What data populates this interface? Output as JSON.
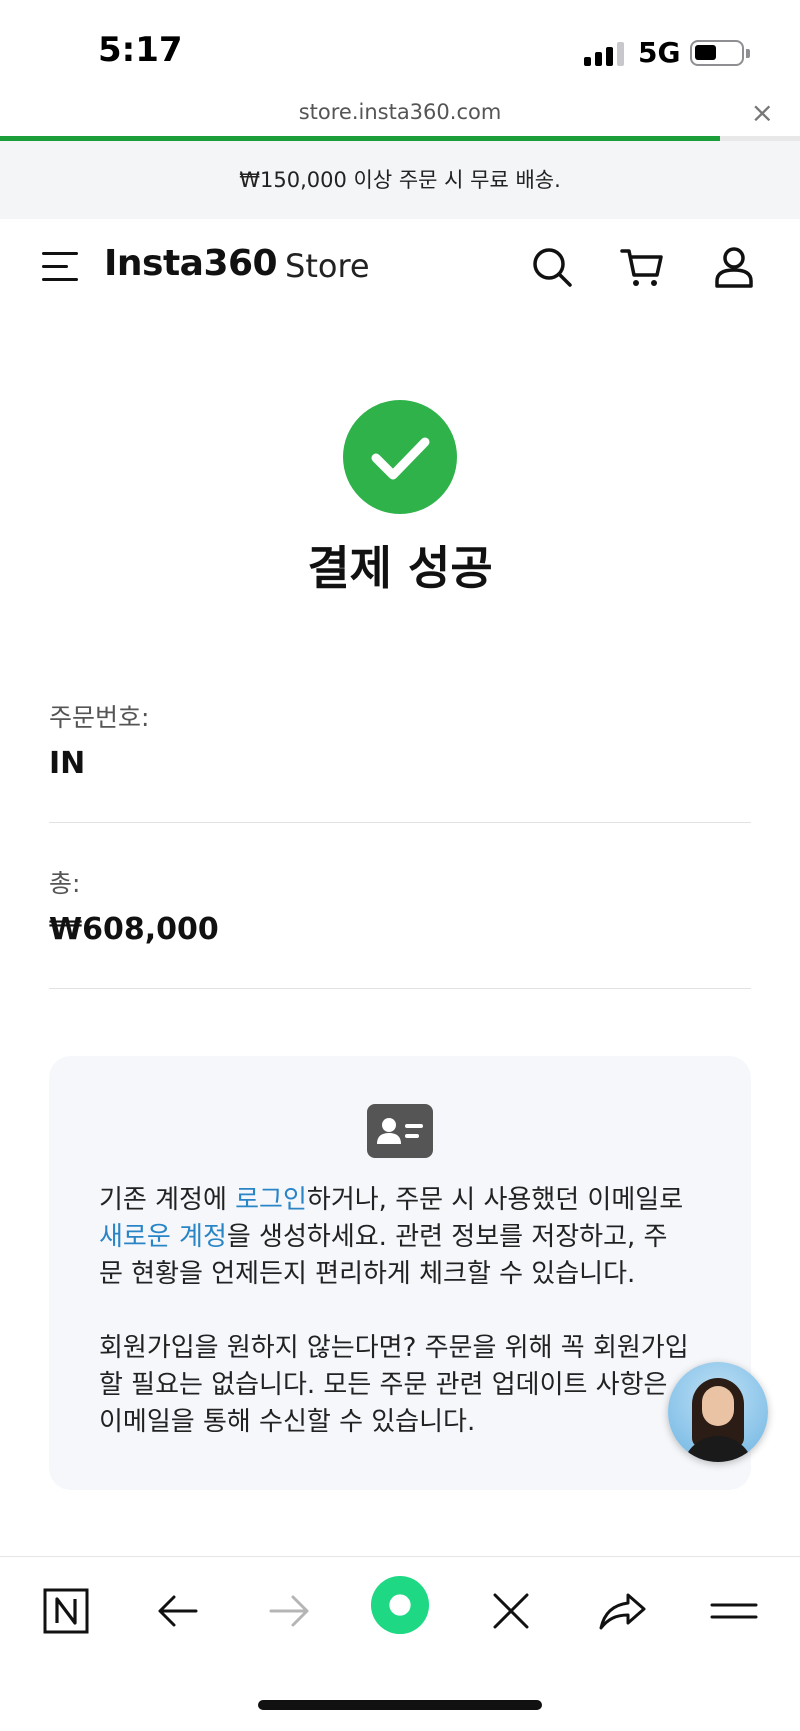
{
  "status_bar": {
    "time": "5:17",
    "network": "5G",
    "signal_bars_filled": 3,
    "signal_bars_total": 4,
    "battery_level": 0.45
  },
  "browser": {
    "url": "store.insta360.com",
    "close_glyph": "×",
    "load_progress": 0.9
  },
  "promo": {
    "text": "₩150,000 이상 주문 시 무료 배송."
  },
  "header": {
    "brand": "Insta360",
    "store_label": "Store",
    "icons": [
      "menu-icon",
      "search-icon",
      "cart-icon",
      "account-icon"
    ]
  },
  "success": {
    "icon": "check-circle-icon",
    "title": "결제 성공"
  },
  "order": {
    "number_label": "주문번호:",
    "number_value_visible": "IN",
    "total_label": "총:",
    "total_value": "₩608,000"
  },
  "account_card": {
    "icon": "id-card-icon",
    "p1_part1": "기존 계정에 ",
    "p1_login_link": "로그인",
    "p1_part2": "하거나, 주문 시 사용했던 이메일로",
    "p1_newaccount_link": "새로운 계정",
    "p1_part3": "을 생성하세요. 관련 정보를 저장하고, 주",
    "p1_part4": "문 현황을 언제든지 편리하게 체크할 수 있습니다.",
    "p2_line1": "회원가입을 원하지 않는다면? 주문을 위해 꼭 회원가입",
    "p2_line2": "할 필요는 없습니다. 모든 주문 관련 업데이트 사항은",
    "p2_line3": "이메일을 통해 수신할 수 있습니다."
  },
  "chat": {
    "icon": "chat-agent-avatar"
  },
  "toolbar": {
    "icons": [
      "naver-n-icon",
      "back-arrow-icon",
      "forward-arrow-icon",
      "green-dot-icon",
      "close-tab-icon",
      "share-icon",
      "menu-lines-icon"
    ],
    "colors": {
      "accent_green": "#1fd884",
      "success_green": "#2fb24a",
      "link_blue": "#2a85c6"
    }
  }
}
